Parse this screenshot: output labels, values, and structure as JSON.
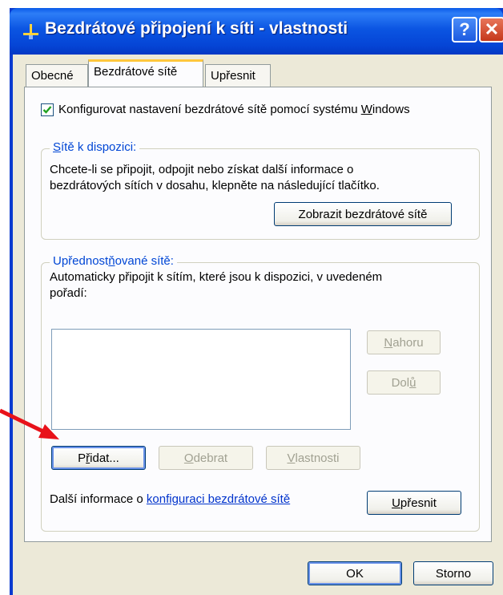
{
  "window": {
    "title": "Bezdrátové připojení k síti - vlastnosti",
    "help_glyph": "?",
    "close_glyph": "✕"
  },
  "tabs": [
    {
      "label": "Obecné",
      "active": false
    },
    {
      "label": "Bezdrátové sítě",
      "active": true
    },
    {
      "label": "Upřesnit",
      "active": false
    }
  ],
  "config": {
    "checkbox_checked": true,
    "label_pre": "Konfigurovat nastavení bezdrátové sítě pomocí systému ",
    "label_ul": "W",
    "label_post": "indows"
  },
  "available": {
    "legend_ul": "S",
    "legend_rest": "ítě k dispozici:",
    "text1": "Chcete-li se připojit, odpojit nebo získat další informace o",
    "text2": "bezdrátových sítích v dosahu, klepněte na následující tlačítko.",
    "view_button": "Zobrazit bezdrátové sítě"
  },
  "preferred": {
    "legend_pre": "Upřednost",
    "legend_ul": "ň",
    "legend_post": "ované sítě:",
    "text1": "Automaticky připojit k sítím, které jsou k dispozici, v uvedeném",
    "text2": "pořadí:",
    "up_ul": "N",
    "up_rest": "ahoru",
    "down_pre": "Dol",
    "down_ul": "ů",
    "add_pre": "P",
    "add_ul": "ř",
    "add_post": "idat...",
    "remove_ul": "O",
    "remove_rest": "debrat",
    "props_ul": "V",
    "props_rest": "lastnosti"
  },
  "footer": {
    "info_text": "Další informace o ",
    "info_link": "konfiguraci bezdrátové sítě",
    "advanced_ul": "U",
    "advanced_rest": "přesnit"
  },
  "dialog": {
    "ok": "OK",
    "cancel": "Storno"
  },
  "colors": {
    "titlebar": "#0a5ae8",
    "legend": "#0046d5",
    "annotation_arrow": "#e8121a"
  }
}
